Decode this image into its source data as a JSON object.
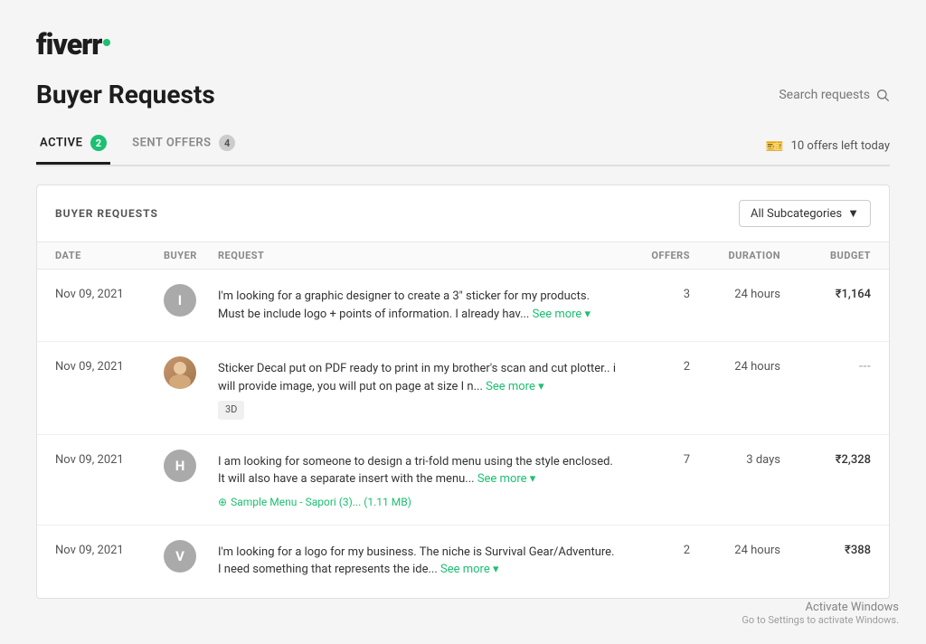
{
  "logo": {
    "text": "fiverr",
    "dot_color": "#1dbf73"
  },
  "header": {
    "title": "Buyer Requests",
    "search_placeholder": "Search requests"
  },
  "tabs": [
    {
      "label": "ACTIVE",
      "badge": "2",
      "active": true,
      "badge_color": "green"
    },
    {
      "label": "SENT OFFERS",
      "badge": "4",
      "active": false,
      "badge_color": "gray"
    }
  ],
  "offers_left": "10 offers left today",
  "table": {
    "title": "BUYER REQUESTS",
    "subcategory_label": "All Subcategories",
    "columns": [
      "DATE",
      "BUYER",
      "REQUEST",
      "OFFERS",
      "DURATION",
      "BUDGET"
    ],
    "rows": [
      {
        "date": "Nov 09, 2021",
        "avatar_letter": "I",
        "avatar_type": "letter",
        "avatar_color": "#aaa",
        "request": "I'm looking for a graphic designer to create a 3\" sticker for my products. Must be include logo + points of information. I already hav...",
        "see_more": "See more",
        "offers": "3",
        "duration": "24 hours",
        "budget": "₹1,164",
        "tag": null,
        "attachment": null
      },
      {
        "date": "Nov 09, 2021",
        "avatar_letter": null,
        "avatar_type": "image",
        "avatar_color": "#c0a080",
        "request": "Sticker Decal put on PDF ready to print in my brother's scan and cut plotter.. i will provide image, you will put on page at size I n...",
        "see_more": "See more",
        "offers": "2",
        "duration": "24 hours",
        "budget": "---",
        "tag": "3D",
        "attachment": null
      },
      {
        "date": "Nov 09, 2021",
        "avatar_letter": "H",
        "avatar_type": "letter",
        "avatar_color": "#aaa",
        "request": "I am looking for someone to design a tri-fold menu using the style enclosed. It will also have a separate insert with the menu...",
        "see_more": "See more",
        "offers": "7",
        "duration": "3 days",
        "budget": "₹2,328",
        "tag": null,
        "attachment": "Sample Menu - Sapori (3)...  (1.11 MB)"
      },
      {
        "date": "Nov 09, 2021",
        "avatar_letter": "V",
        "avatar_type": "letter",
        "avatar_color": "#aaa",
        "request": "I'm looking for a logo for my business. The niche is Survival Gear/Adventure. I need something that represents the ide...",
        "see_more": "See more",
        "offers": "2",
        "duration": "24 hours",
        "budget": "₹388",
        "tag": null,
        "attachment": null
      }
    ]
  },
  "activation": {
    "title": "Activate Windows",
    "sub": "Go to Settings to activate Windows."
  }
}
